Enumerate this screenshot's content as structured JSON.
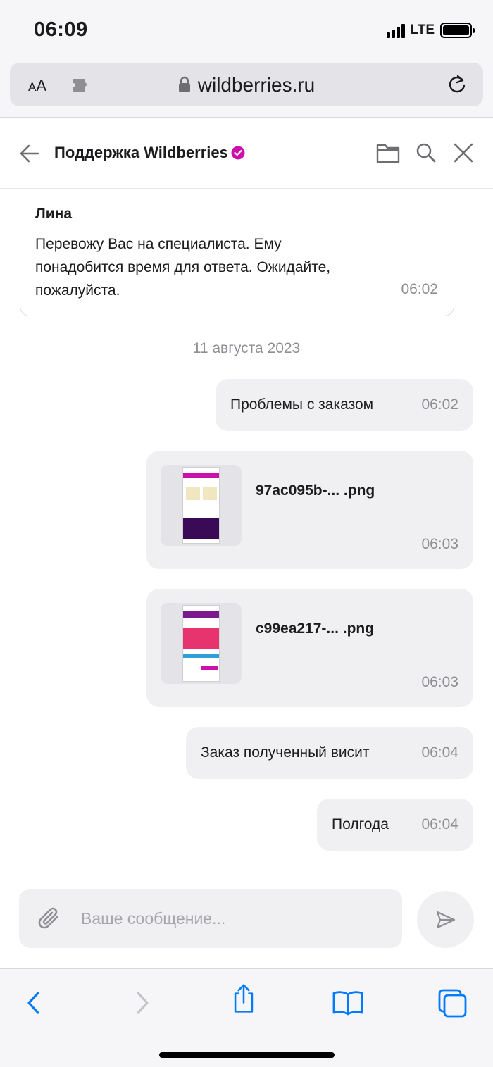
{
  "status_bar": {
    "time": "06:09",
    "network": "LTE"
  },
  "browser": {
    "text_size_label_small": "A",
    "text_size_label_large": "A",
    "url": "wildberries.ru"
  },
  "chat": {
    "title": "Поддержка Wildberries"
  },
  "messages": {
    "incoming": {
      "author": "Лина",
      "text": "Перевожу Вас на специалиста. Ему понадобится время для ответа. Ожидайте, пожалуйста.",
      "time": "06:02"
    },
    "date_separator": "11 августа 2023",
    "outgoing": [
      {
        "text": "Проблемы с заказом",
        "time": "06:02"
      },
      {
        "file_name": "97ac095b-... .png",
        "time": "06:03"
      },
      {
        "file_name": "c99ea217-... .png",
        "time": "06:03"
      },
      {
        "text": "Заказ полученный висит",
        "time": "06:04"
      },
      {
        "text": "Полгода",
        "time": "06:04"
      }
    ]
  },
  "composer": {
    "placeholder": "Ваше сообщение..."
  },
  "colors": {
    "accent": "#cb11ab",
    "ios_blue": "#007aff",
    "bubble": "#f0f0f2",
    "muted": "#8e8e93"
  }
}
